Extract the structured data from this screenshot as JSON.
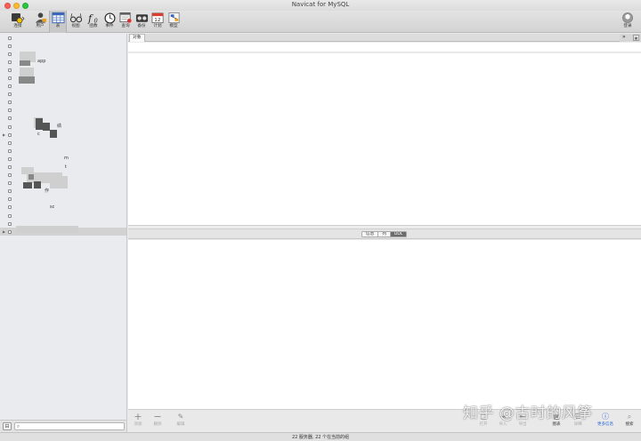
{
  "window": {
    "title": "Navicat for MySQL"
  },
  "toolbar": {
    "items": [
      {
        "label": "连接",
        "icon": "connection-icon"
      },
      {
        "label": "用户",
        "icon": "user-icon"
      },
      {
        "label": "表",
        "icon": "table-icon"
      },
      {
        "label": "视图",
        "icon": "view-icon"
      },
      {
        "label": "函数",
        "icon": "function-icon"
      },
      {
        "label": "事件",
        "icon": "event-icon"
      },
      {
        "label": "查询",
        "icon": "query-icon"
      },
      {
        "label": "备份",
        "icon": "backup-icon"
      },
      {
        "label": "计划",
        "icon": "schedule-icon"
      },
      {
        "label": "模型",
        "icon": "model-icon"
      }
    ],
    "active": "表",
    "login_label": "登录"
  },
  "sidebar": {
    "visible_fragments": [
      "app",
      "绩",
      "c",
      "m",
      "t",
      "作",
      "sc"
    ]
  },
  "main": {
    "tab_label": "对象"
  },
  "info": {
    "tabs": [
      "信息",
      "列",
      "DDL"
    ],
    "active_tab": "DDL"
  },
  "actions": {
    "add_label": "添加",
    "delete_label": "删除",
    "edit_label": "编辑",
    "open_label": "打开",
    "import_label": "导入",
    "export_label": "导出",
    "view_label": "图表",
    "detail_label": "详细",
    "more_info_label": "更多信息",
    "search_label": "搜索"
  },
  "status": {
    "text": "22 服务器, 22 个在当前的组"
  },
  "watermark": "知乎 @古时的风筝",
  "colors": {
    "selected_blue": "#2a66d9",
    "active_segment": "#6b6b6b"
  }
}
